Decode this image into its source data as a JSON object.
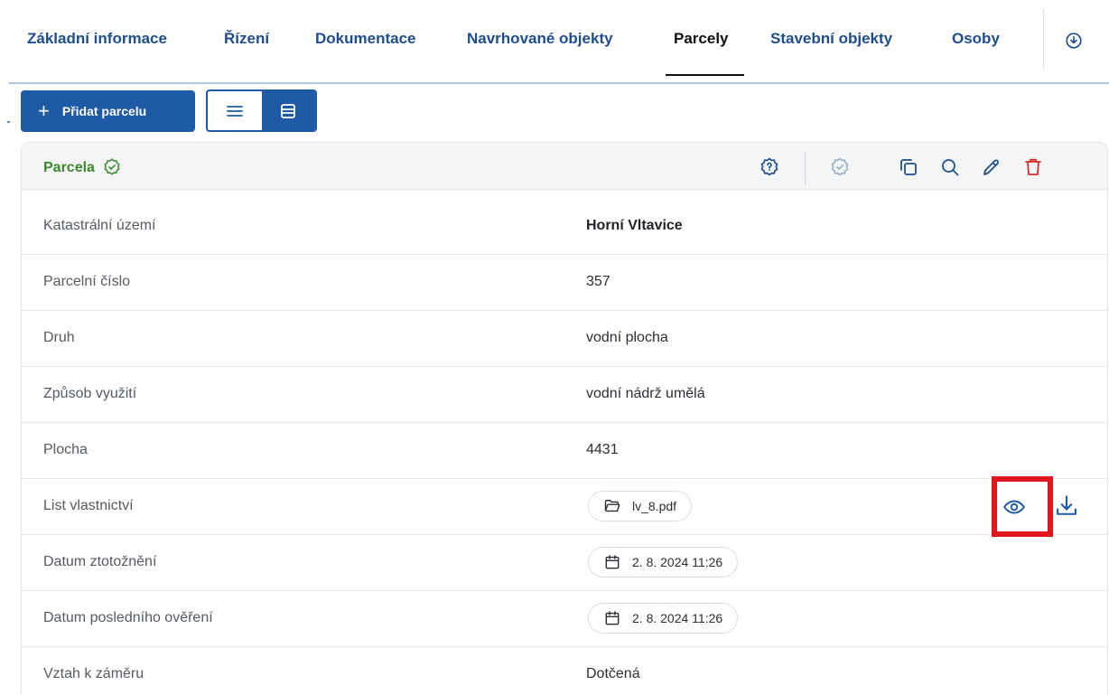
{
  "tabs": [
    {
      "label": "Základní informace",
      "active": false
    },
    {
      "label": "Řízení",
      "active": false
    },
    {
      "label": "Dokumentace",
      "active": false
    },
    {
      "label": "Navrhované objekty",
      "active": false
    },
    {
      "label": "Parcely",
      "active": true
    },
    {
      "label": "Stavební objekty",
      "active": false
    },
    {
      "label": "Osoby",
      "active": false
    }
  ],
  "toolbar": {
    "add_label": "Přidat parcelu",
    "add_icon": "plus-icon",
    "view_options": [
      "list-view-icon",
      "table-view-icon"
    ],
    "selected_view": "table-view-icon"
  },
  "card": {
    "title": "Parcela",
    "title_icon": "verified-shield-icon",
    "actions": [
      "shield-question-icon",
      "shield-check-icon",
      "copy-icon",
      "search-icon",
      "edit-icon",
      "delete-icon"
    ],
    "rows": [
      {
        "label": "Katastrální území",
        "value": "Horní Vltavice",
        "type": "bold"
      },
      {
        "label": "Parcelní číslo",
        "value": "357",
        "type": "text"
      },
      {
        "label": "Druh",
        "value": "vodní plocha",
        "type": "text"
      },
      {
        "label": "Způsob využití",
        "value": "vodní nádrž umělá",
        "type": "text"
      },
      {
        "label": "Plocha",
        "value": "4431",
        "type": "text"
      },
      {
        "label": "List vlastnictví",
        "value": "lv_8.pdf",
        "type": "file"
      },
      {
        "label": "Datum ztotožnění",
        "value": "2. 8. 2024 11:26",
        "type": "date"
      },
      {
        "label": "Datum posledního ověření",
        "value": "2. 8. 2024 11:26",
        "type": "date"
      },
      {
        "label": "Vztah k záměru",
        "value": "Dotčená",
        "type": "text"
      }
    ]
  },
  "colors": {
    "primary": "#1f5aa6",
    "tab_text": "#1f4e8c",
    "title_green": "#3d8a2e",
    "delete_red": "#d42b2b",
    "highlight": "#e3161d"
  }
}
